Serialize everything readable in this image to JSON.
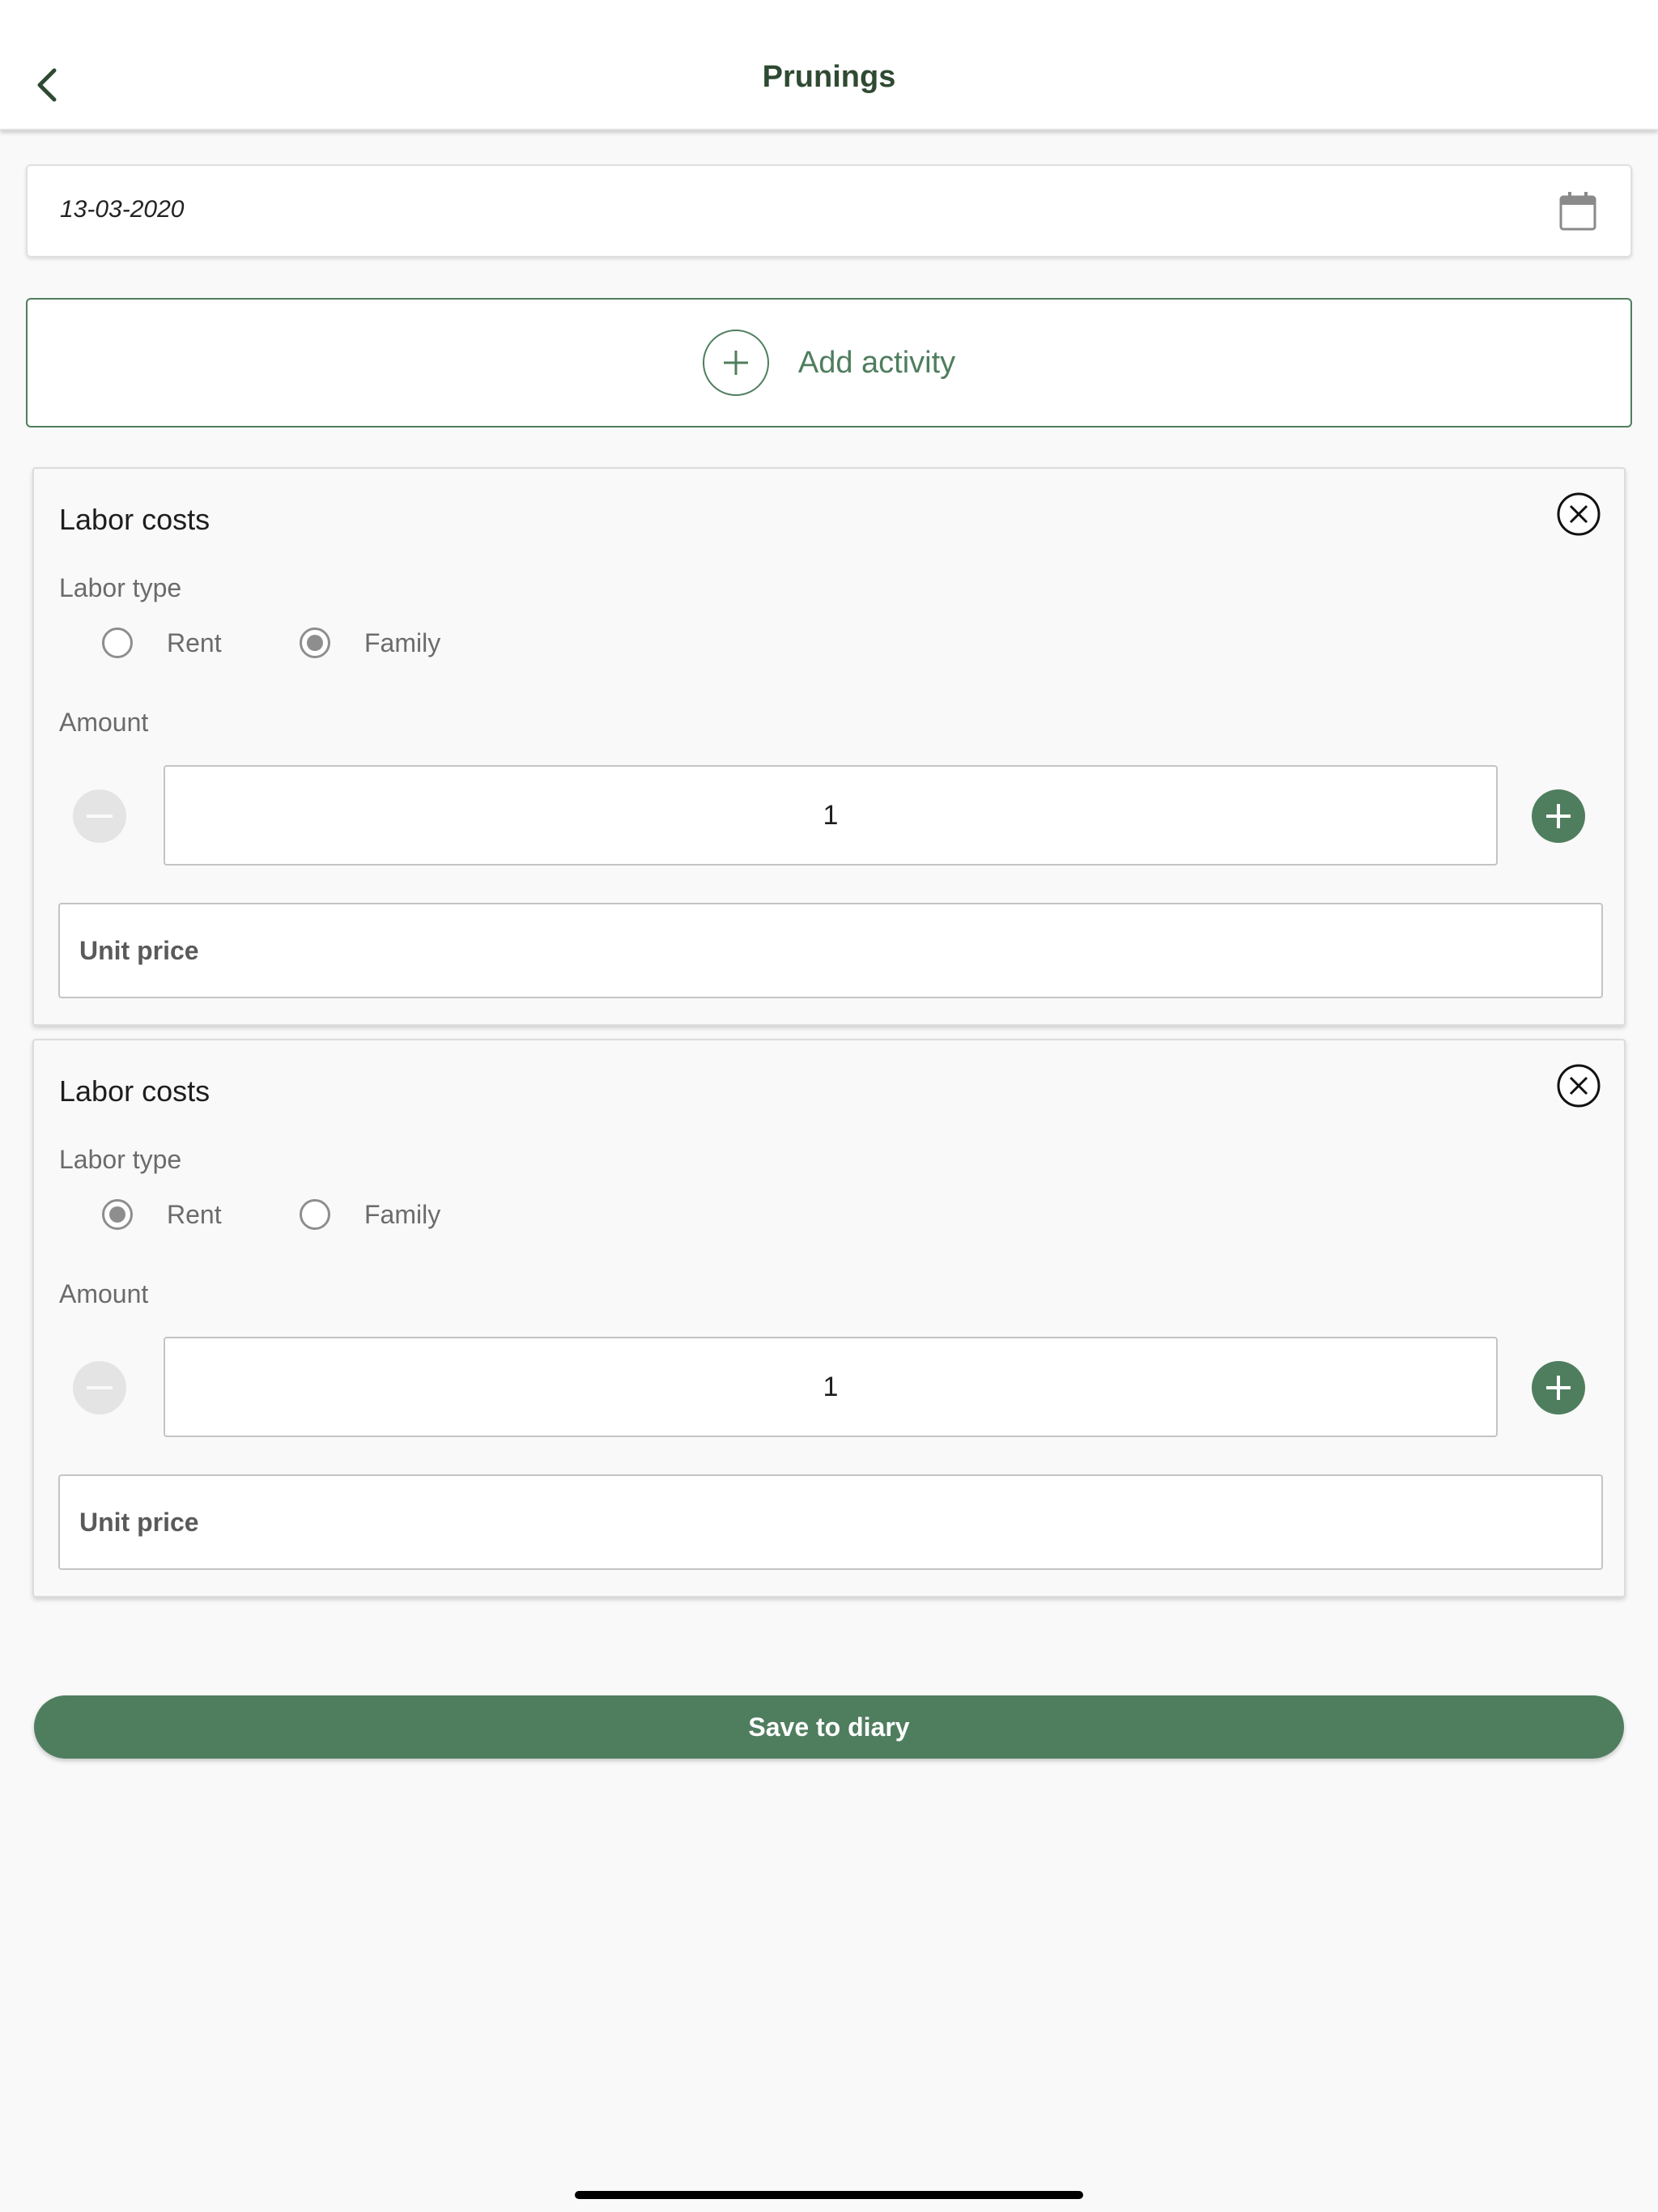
{
  "header": {
    "title": "Prunings"
  },
  "date_field": {
    "value": "13-03-2020"
  },
  "add_activity": {
    "label": "Add activity"
  },
  "cards": [
    {
      "title": "Labor costs",
      "labor_type_label": "Labor type",
      "options": [
        {
          "label": "Rent",
          "selected": false
        },
        {
          "label": "Family",
          "selected": true
        }
      ],
      "amount_label": "Amount",
      "amount_value": "1",
      "unit_price_placeholder": "Unit price"
    },
    {
      "title": "Labor costs",
      "labor_type_label": "Labor type",
      "options": [
        {
          "label": "Rent",
          "selected": true
        },
        {
          "label": "Family",
          "selected": false
        }
      ],
      "amount_label": "Amount",
      "amount_value": "1",
      "unit_price_placeholder": "Unit price"
    }
  ],
  "save_button": {
    "label": "Save to diary"
  },
  "colors": {
    "accent": "#4f7e5e",
    "title": "#2f4a32",
    "background": "#f9f9f9"
  },
  "icons": {
    "back": "chevron-left-icon",
    "calendar": "calendar-icon",
    "add": "plus-circle-icon",
    "close": "close-circle-icon",
    "minus": "minus-icon",
    "plus": "plus-icon"
  }
}
